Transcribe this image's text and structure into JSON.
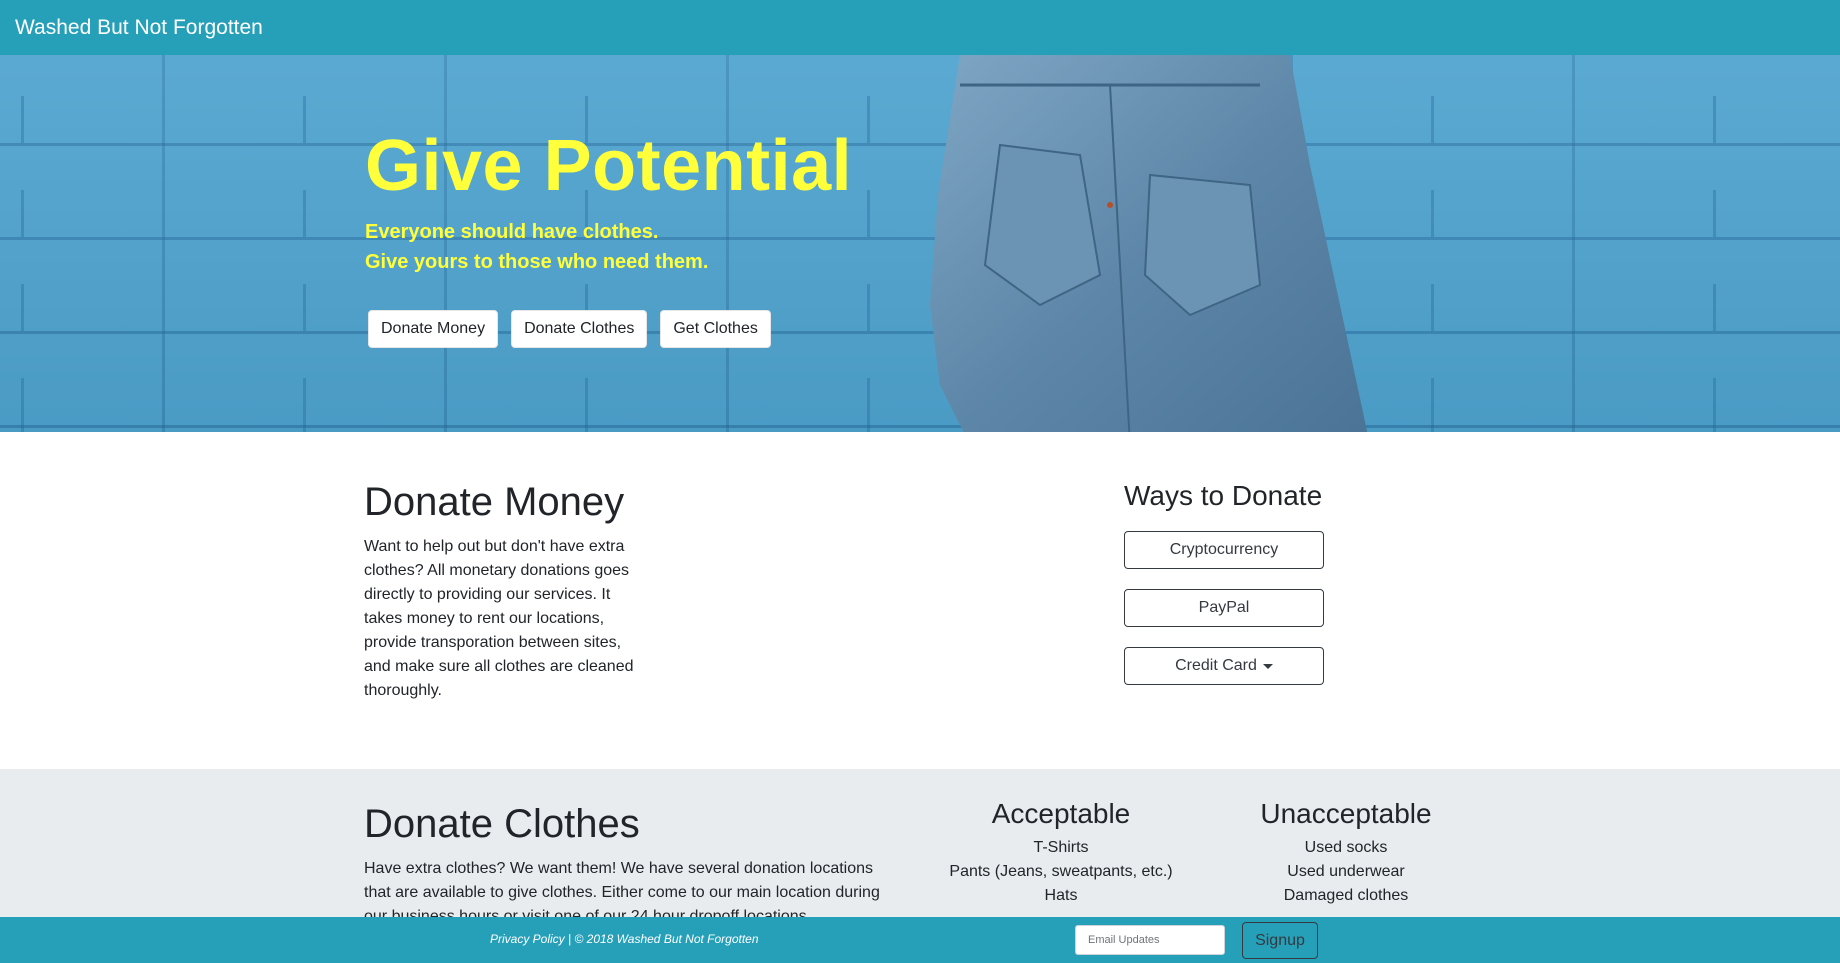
{
  "navbar": {
    "brand": "Washed But Not Forgotten"
  },
  "hero": {
    "title": "Give Potential",
    "subtitle_line1": "Everyone should have clothes.",
    "subtitle_line2": "Give yours to those who need them.",
    "buttons": [
      "Donate Money",
      "Donate Clothes",
      "Get Clothes"
    ],
    "title_color": "#ffff3c",
    "background_color": "#4ea3cf"
  },
  "donate_money": {
    "title": "Donate Money",
    "text": "Want to help out but don't have extra clothes? All monetary donations goes directly to providing our services. It takes money to rent our locations, provide transporation between sites, and make sure all clothes are cleaned thoroughly.",
    "ways_title": "Ways to Donate",
    "ways": [
      "Cryptocurrency",
      "PayPal",
      "Credit Card"
    ]
  },
  "donate_clothes": {
    "title": "Donate Clothes",
    "text": "Have extra clothes? We want them! We have several donation locations that are available to give clothes. Either come to our main location during our business hours or visit one of our 24 hour dropoff locations.",
    "acceptable_title": "Acceptable",
    "acceptable": [
      "T-Shirts",
      "Pants (Jeans, sweatpants, etc.)",
      "Hats"
    ],
    "unacceptable_title": "Unacceptable",
    "unacceptable": [
      "Used socks",
      "Used underwear",
      "Damaged clothes"
    ]
  },
  "footer": {
    "privacy_link": "Privacy Policy",
    "copyright": " | © 2018 Washed But Not Forgotten",
    "email_placeholder": "Email Updates",
    "signup_label": "Signup"
  },
  "colors": {
    "primary": "#26a0b9",
    "section_gray": "#e9ecef"
  }
}
